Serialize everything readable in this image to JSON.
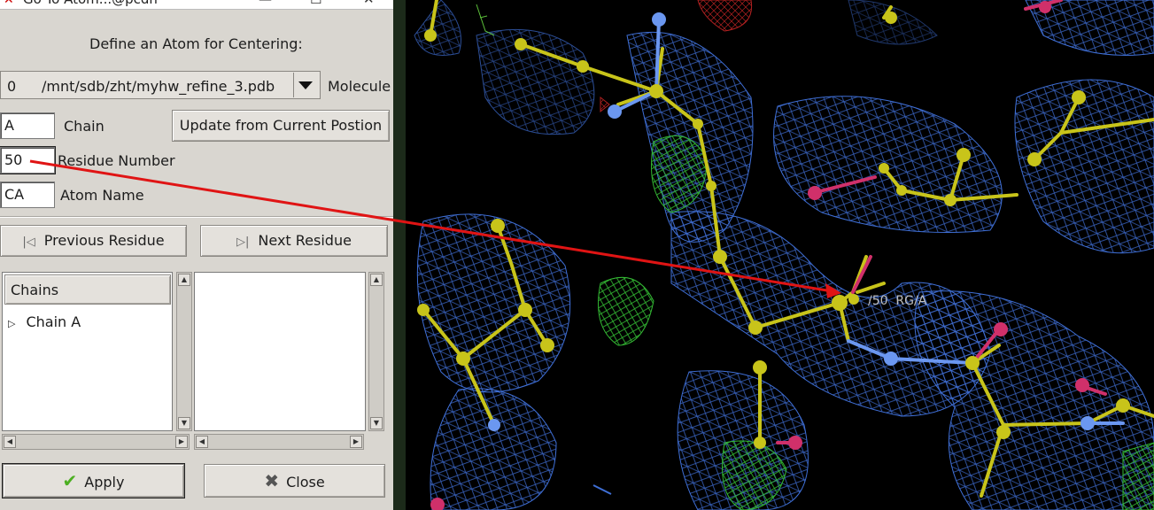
{
  "window": {
    "title": "Go To Atom...@pcdh"
  },
  "dialog": {
    "heading": "Define an Atom for Centering:",
    "molecule": {
      "index": "0",
      "path": "/mnt/sdb/zht/myhw_refine_3.pdb",
      "label": "Molecule"
    },
    "chain": {
      "value": "A",
      "label": "Chain"
    },
    "update_button": "Update from Current Postion",
    "residue": {
      "value": "50",
      "label": "Residue Number"
    },
    "atom": {
      "value": "CA",
      "label": "Atom Name"
    },
    "prev_button": "Previous Residue",
    "next_button": "Next Residue",
    "chains_header": "Chains",
    "chain_items": [
      "Chain A"
    ],
    "apply_button": "Apply",
    "close_button": "Close"
  },
  "viewer": {
    "atom_label": "/50  RG/A"
  },
  "colors": {
    "dialog_bg": "#d9d6d0",
    "density_blue": "#3f6fd6",
    "density_green": "#33b833",
    "bond_yellow": "#c8c41a",
    "nitrogen_blue": "#6b97f0",
    "oxygen_red": "#d0306a",
    "annotation_red": "#e01414"
  },
  "icons": {
    "prev": "skip-back-icon",
    "next": "skip-forward-icon",
    "apply": "checkmark-icon",
    "close": "x-icon",
    "combo": "triangle-down-icon"
  }
}
